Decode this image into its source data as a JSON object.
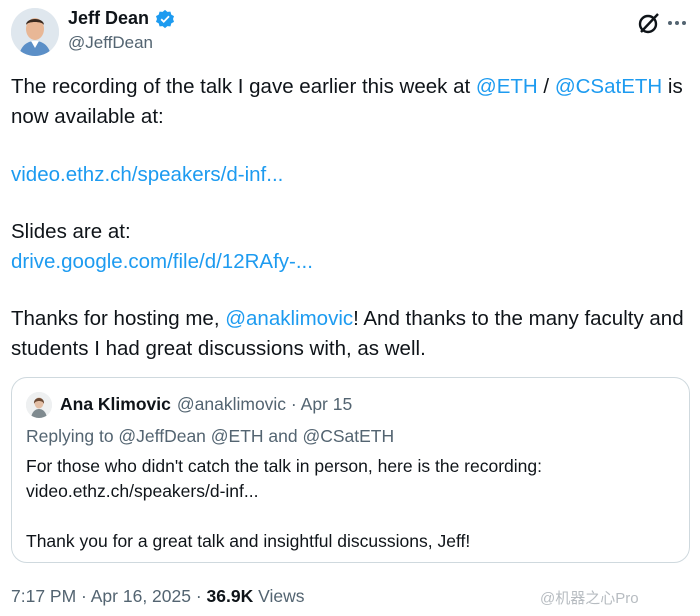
{
  "author": {
    "name": "Jeff Dean",
    "handle": "@JeffDean"
  },
  "icons": {
    "verified": "verified-badge-icon",
    "grok": "grok-icon",
    "more": "more-dots-icon"
  },
  "tweet": {
    "line1_pre": "The recording of the talk I gave earlier this week at ",
    "mention_eth": "@ETH",
    "slash": " / ",
    "mention_csateth": "@CSatETH",
    "line1_post": " is now available at:",
    "link_video": "video.ethz.ch/speakers/d-inf...",
    "slides_label": "Slides are at:",
    "link_slides": "drive.google.com/file/d/12RAfy-...",
    "thanks_pre": "Thanks for hosting me, ",
    "mention_ana": "@anaklimovic",
    "thanks_post": "!  And thanks to the many faculty and students I had great discussions with, as well."
  },
  "quote": {
    "name": "Ana Klimovic",
    "handle_date": "@anaklimovic · Apr 15",
    "replying": "Replying to @JeffDean @ETH and @CSatETH",
    "line1": "For those who didn't catch the talk in person, here is the recording:",
    "line2": "video.ethz.ch/speakers/d-inf...",
    "line3": "Thank you for a great talk and insightful discussions, Jeff!"
  },
  "footer": {
    "time_date": "7:17 PM · Apr 16, 2025 · ",
    "views_count": "36.9K",
    "views_label": " Views"
  },
  "watermark": "@机器之心Pro",
  "colors": {
    "link": "#1d9bf0",
    "text": "#0f1419",
    "muted": "#536471",
    "border": "#cfd9de"
  }
}
